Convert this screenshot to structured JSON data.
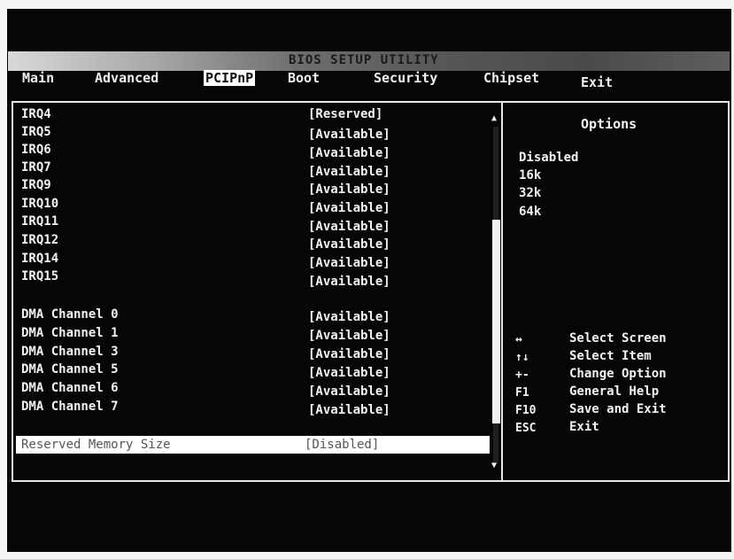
{
  "header": {
    "title": "BIOS SETUP UTILITY"
  },
  "tabs": [
    {
      "label": "Main"
    },
    {
      "label": "Advanced"
    },
    {
      "label": "PCIPnP"
    },
    {
      "label": "Boot"
    },
    {
      "label": "Security"
    },
    {
      "label": "Chipset"
    },
    {
      "label": "Exit"
    }
  ],
  "active_tab": "PCIPnP",
  "settings": [
    {
      "label": "IRQ4",
      "value": "[Reserved]"
    },
    {
      "label": "IRQ5",
      "value": "[Available]"
    },
    {
      "label": "IRQ6",
      "value": "[Available]"
    },
    {
      "label": "IRQ7",
      "value": "[Available]"
    },
    {
      "label": "IRQ9",
      "value": "[Available]"
    },
    {
      "label": "IRQ10",
      "value": "[Available]"
    },
    {
      "label": "IRQ11",
      "value": "[Available]"
    },
    {
      "label": "IRQ12",
      "value": "[Available]"
    },
    {
      "label": "IRQ14",
      "value": "[Available]"
    },
    {
      "label": "IRQ15",
      "value": "[Available]"
    },
    {
      "label": "DMA Channel 0",
      "value": "[Available]"
    },
    {
      "label": "DMA Channel 1",
      "value": "[Available]"
    },
    {
      "label": "DMA Channel 3",
      "value": "[Available]"
    },
    {
      "label": "DMA Channel 5",
      "value": "[Available]"
    },
    {
      "label": "DMA Channel 6",
      "value": "[Available]"
    },
    {
      "label": "DMA Channel 7",
      "value": "[Available]"
    }
  ],
  "selected_setting": {
    "label": "Reserved Memory Size",
    "value": "[Disabled]"
  },
  "options_panel": {
    "title": "Options",
    "items": [
      "Disabled",
      "16k",
      "32k",
      "64k"
    ]
  },
  "help_keys": [
    {
      "key": "↔",
      "desc": "Select Screen"
    },
    {
      "key": "↑↓",
      "desc": "Select Item"
    },
    {
      "key": "+-",
      "desc": "Change Option"
    },
    {
      "key": "F1",
      "desc": "General Help"
    },
    {
      "key": "F10",
      "desc": "Save and Exit"
    },
    {
      "key": "ESC",
      "desc": "Exit"
    }
  ],
  "colors": {
    "background": "#060606",
    "text": "#f2f2f2",
    "highlight": "#ffffff"
  }
}
